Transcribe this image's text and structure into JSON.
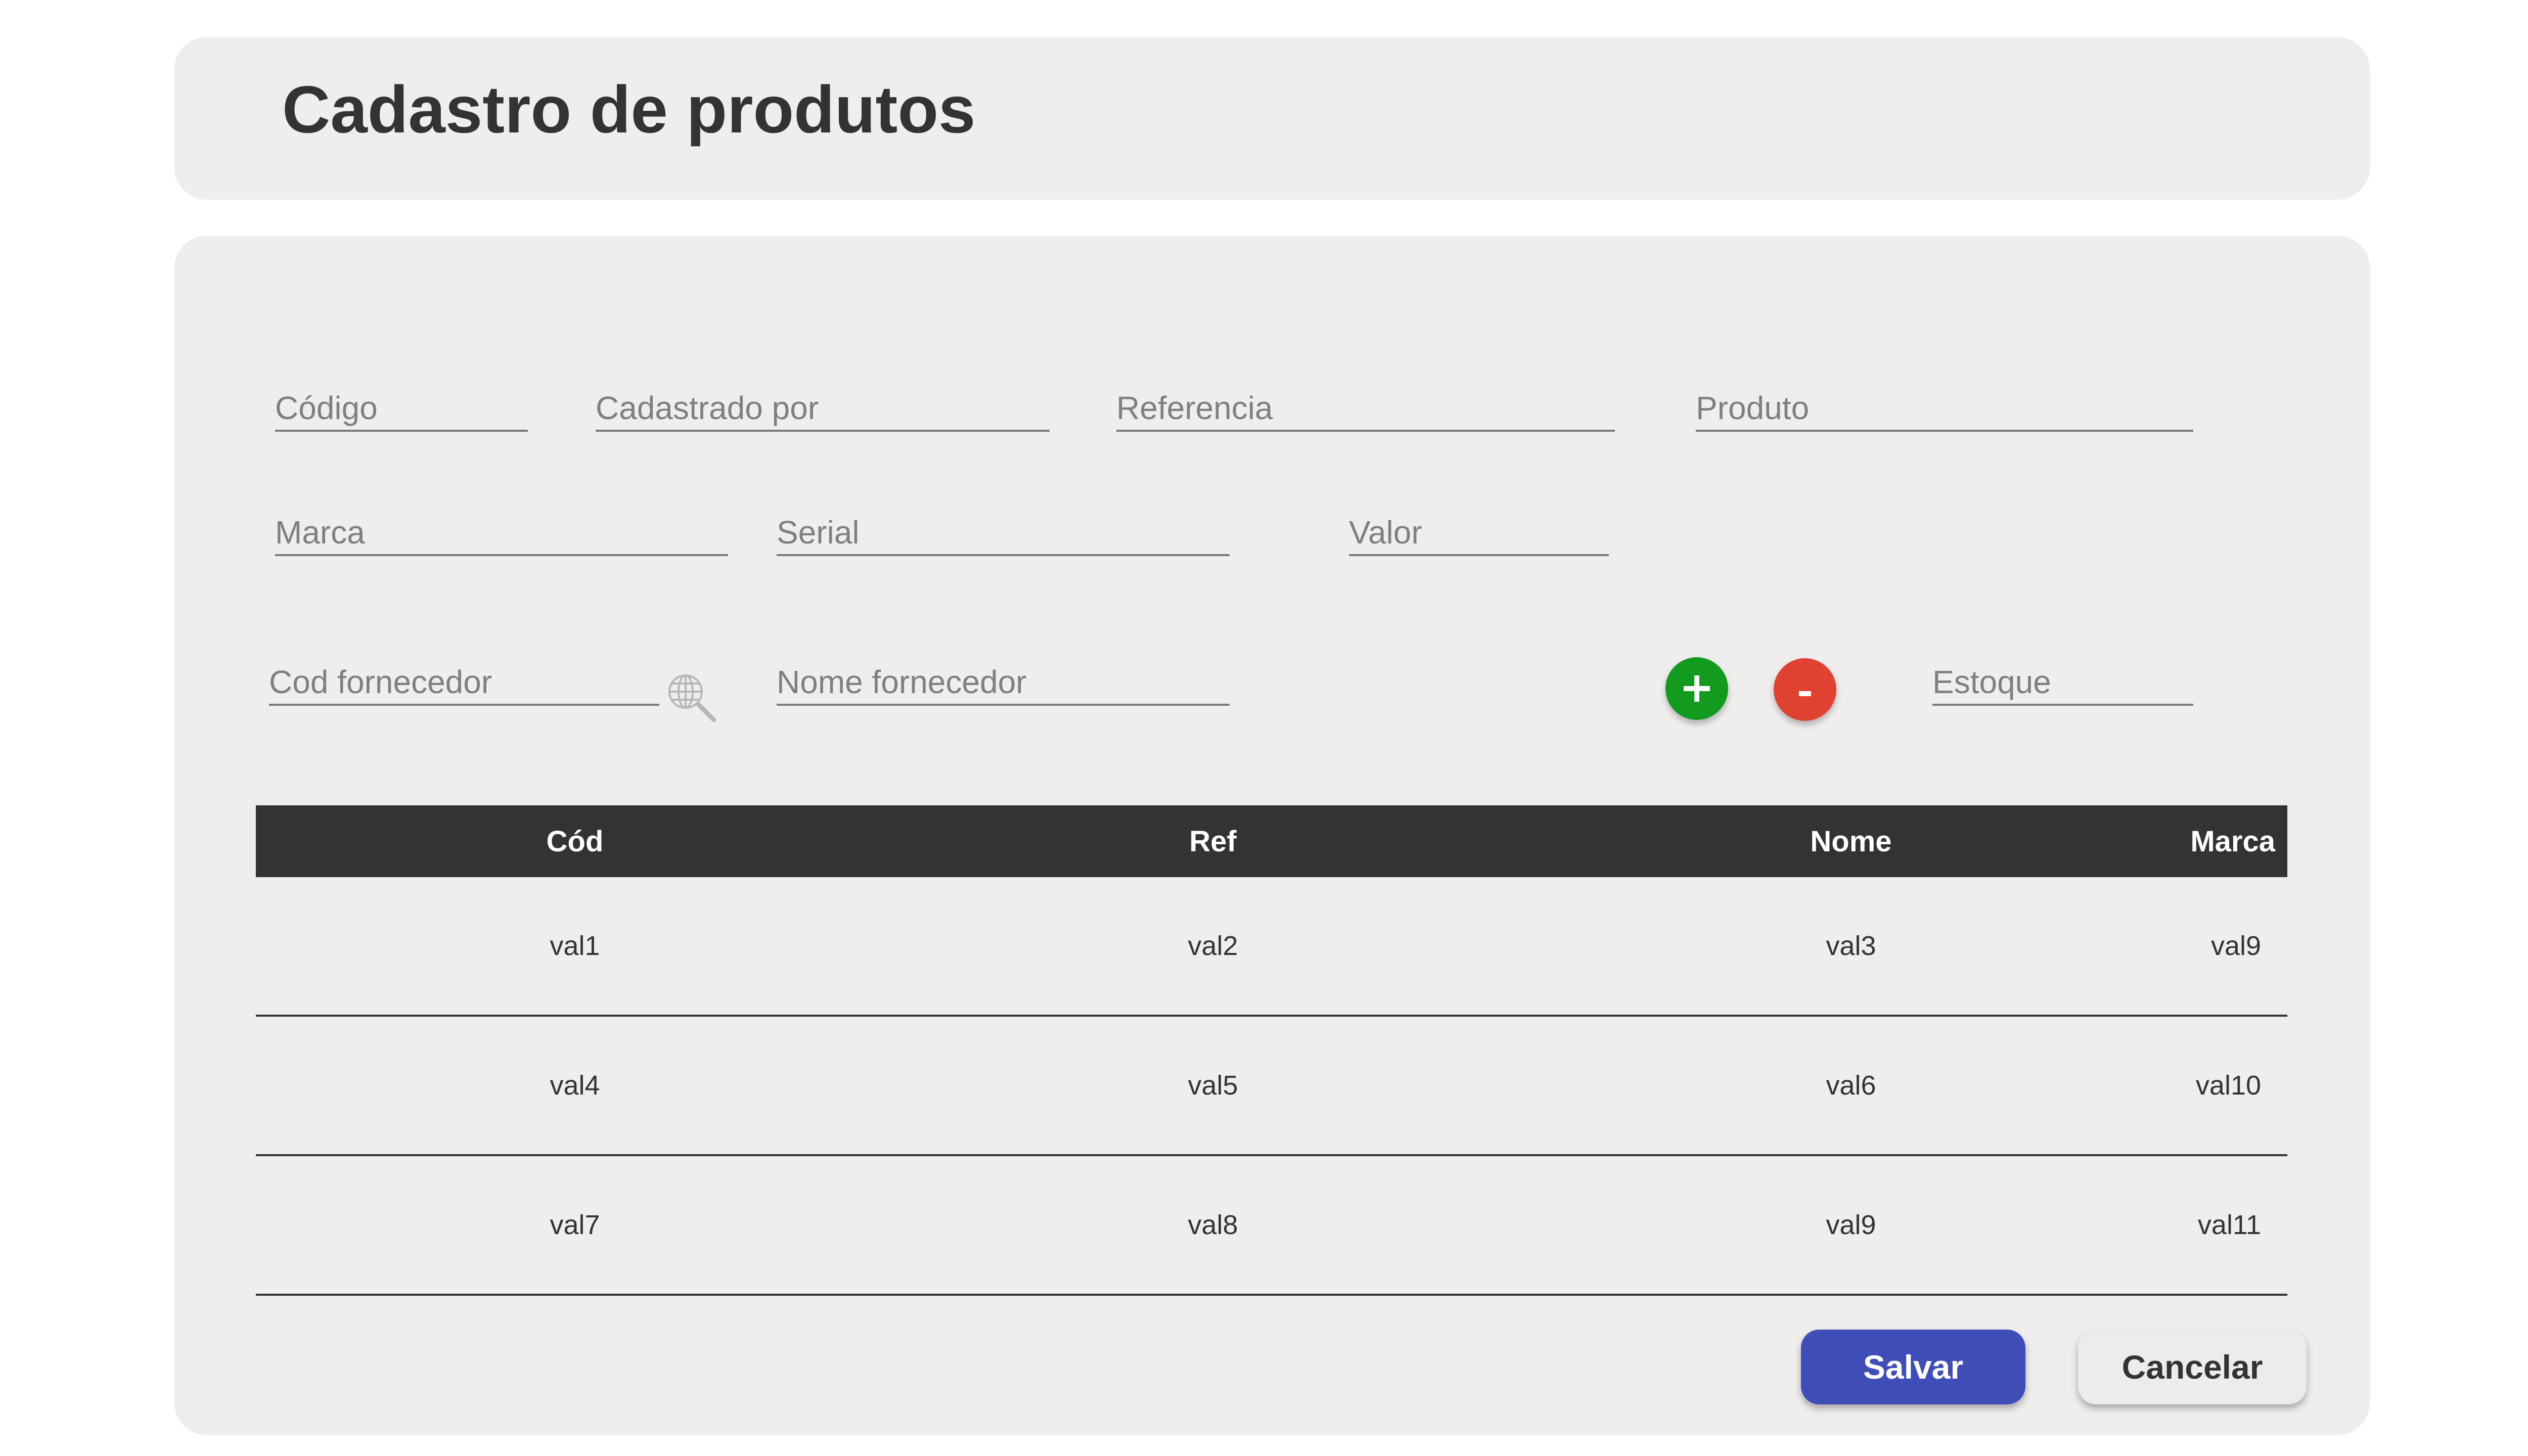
{
  "header": {
    "title": "Cadastro de produtos"
  },
  "form": {
    "fields": {
      "codigo": {
        "placeholder": "Código",
        "value": ""
      },
      "cadastrado_por": {
        "placeholder": "Cadastrado por",
        "value": ""
      },
      "referencia": {
        "placeholder": "Referencia",
        "value": ""
      },
      "produto": {
        "placeholder": "Produto",
        "value": ""
      },
      "marca": {
        "placeholder": "Marca",
        "value": ""
      },
      "serial": {
        "placeholder": "Serial",
        "value": ""
      },
      "valor": {
        "placeholder": "Valor",
        "value": ""
      },
      "cod_fornecedor": {
        "placeholder": "Cod fornecedor",
        "value": ""
      },
      "nome_fornecedor": {
        "placeholder": "Nome fornecedor",
        "value": ""
      },
      "estoque": {
        "placeholder": "Estoque",
        "value": ""
      }
    },
    "icons": {
      "search": "search-globe-icon",
      "add": "plus-icon",
      "remove": "minus-icon"
    }
  },
  "table": {
    "columns": [
      "Cód",
      "Ref",
      "Nome",
      "Marca"
    ],
    "rows": [
      [
        "val1",
        "val2",
        "val3",
        "val9"
      ],
      [
        "val4",
        "val5",
        "val6",
        "val10"
      ],
      [
        "val7",
        "val8",
        "val9",
        "val11"
      ]
    ]
  },
  "actions": {
    "save_label": "Salvar",
    "cancel_label": "Cancelar"
  },
  "colors": {
    "card_background": "#f0eded",
    "table_header": "#333333",
    "save_button": "#3f4db8",
    "add_button": "#129b1e",
    "remove_button": "#e04130",
    "cancel_button": "#ececec"
  }
}
